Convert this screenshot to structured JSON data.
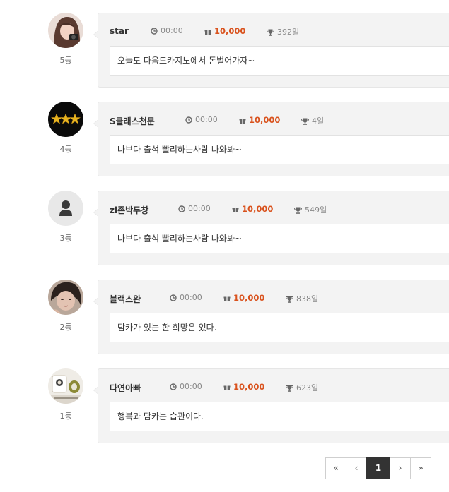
{
  "accent_color": "#d9521d",
  "entries": [
    {
      "rank": "5등",
      "name": "star",
      "time": "00:00",
      "points": "10,000",
      "days": "392일",
      "message": "오늘도 다음드카지노에서 돈벌어가자~",
      "avatar": "photo-girl"
    },
    {
      "rank": "4등",
      "name": "S클래스천문",
      "time": "00:00",
      "points": "10,000",
      "days": "4일",
      "message": "나보다 출석 빨리하는사람 나와봐~",
      "avatar": "three-stars"
    },
    {
      "rank": "3등",
      "name": "zl존박두창",
      "time": "00:00",
      "points": "10,000",
      "days": "549일",
      "message": "나보다 출석 빨리하는사람 나와봐~",
      "avatar": "default-user"
    },
    {
      "rank": "2등",
      "name": "블랙스완",
      "time": "00:00",
      "points": "10,000",
      "days": "838일",
      "message": "담카가 있는 한 희망은 있다.",
      "avatar": "photo-woman"
    },
    {
      "rank": "1등",
      "name": "다연아빠",
      "time": "00:00",
      "points": "10,000",
      "days": "623일",
      "message": "행복과 담카는 습관이다.",
      "avatar": "photo-cup"
    }
  ],
  "pagination": {
    "first": "«",
    "prev": "‹",
    "current": "1",
    "next": "›",
    "last": "»"
  }
}
